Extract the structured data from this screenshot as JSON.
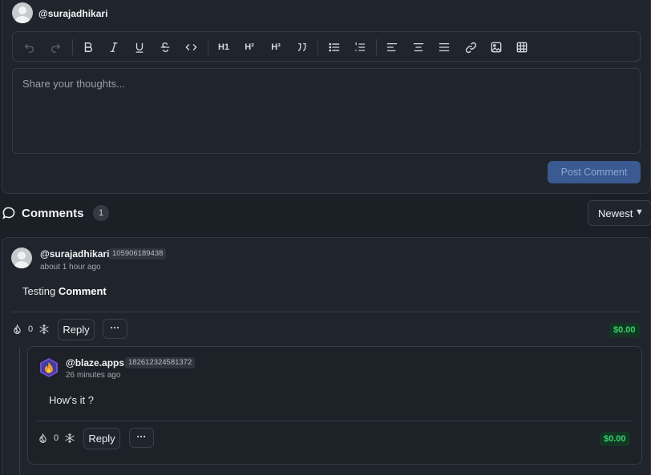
{
  "composer": {
    "username": "@surajadhikari",
    "placeholder": "Share your thoughts...",
    "post_label": "Post Comment",
    "toolbar": {
      "h1": "H1",
      "h2": "H²",
      "h3": "H³"
    }
  },
  "comments_header": {
    "title": "Comments",
    "count": "1",
    "sort_value": "Newest"
  },
  "comments": [
    {
      "username": "@surajadhikari",
      "id": "105906189438",
      "time": "about 1 hour ago",
      "text_plain": "Testing ",
      "text_bold": "Comment",
      "votes": "0",
      "reply_label": "Reply",
      "more_label": "···",
      "amount": "$0.00"
    }
  ],
  "replies": [
    {
      "username": "@blaze.apps",
      "id": "182612324581372",
      "time": "26 minutes ago",
      "text": "How's it ?",
      "votes": "0",
      "reply_label": "Reply",
      "more_label": "···",
      "amount": "$0.00"
    }
  ],
  "colors": {
    "background": "#1b1f26",
    "card": "#20252d",
    "accent_button": "#3a5a91",
    "money_text": "#3ccf6e"
  },
  "icons": [
    "undo-icon",
    "redo-icon",
    "bold-icon",
    "italic-icon",
    "underline-icon",
    "strikethrough-icon",
    "code-icon",
    "heading1-icon",
    "heading2-icon",
    "heading3-icon",
    "quote-icon",
    "bullet-list-icon",
    "numbered-list-icon",
    "align-left-icon",
    "align-center-icon",
    "align-justify-icon",
    "link-icon",
    "image-icon",
    "table-icon",
    "comment-bubble-icon",
    "fire-icon",
    "snowflake-icon"
  ]
}
